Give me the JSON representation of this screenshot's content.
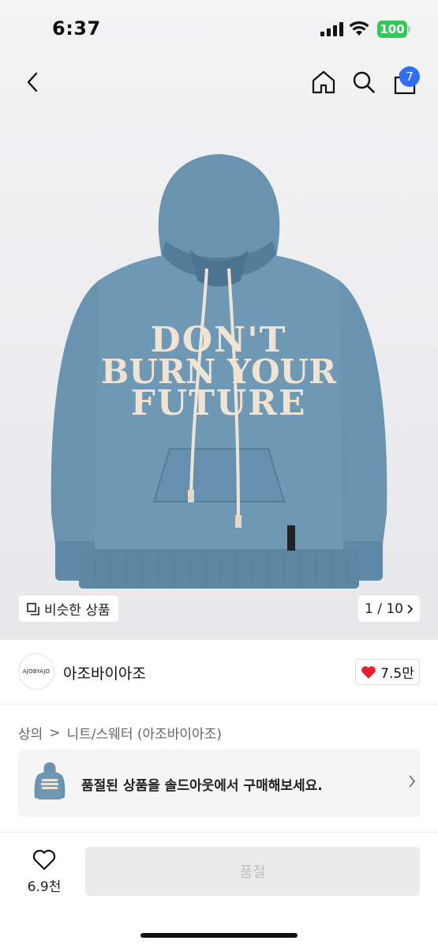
{
  "status_bar": {
    "time": "6:37",
    "battery": "100"
  },
  "nav": {
    "back_icon": "chevron-left-icon",
    "home_icon": "home-icon",
    "search_icon": "search-icon",
    "cart_icon": "shopping-bag-icon",
    "cart_count": "7"
  },
  "product_image": {
    "graphic_text_lines": [
      "DON'T",
      "BURN YOUR",
      "FUTURE"
    ],
    "similar_label": "비슷한 상품",
    "page_counter": "1 / 10"
  },
  "brand": {
    "logo_text": "AJOBYAJO",
    "name": "아조바이아조",
    "like_count": "7.5만"
  },
  "breadcrumb": {
    "category": "상의",
    "separator": ">",
    "subcategory": "니트/스웨터 (아조바이아조)"
  },
  "soldout_banner": {
    "text": "품절된 상품을 솔드아웃에서 구매해보세요."
  },
  "bottom_bar": {
    "wish_count": "6.9천",
    "buy_label": "품절"
  },
  "colors": {
    "hoodie": "#6a93b0",
    "hoodie_dark": "#557d99",
    "graphic": "#efe4d3",
    "badge": "#2f6ff5",
    "heart": "#e5202e",
    "battery": "#34c759"
  }
}
